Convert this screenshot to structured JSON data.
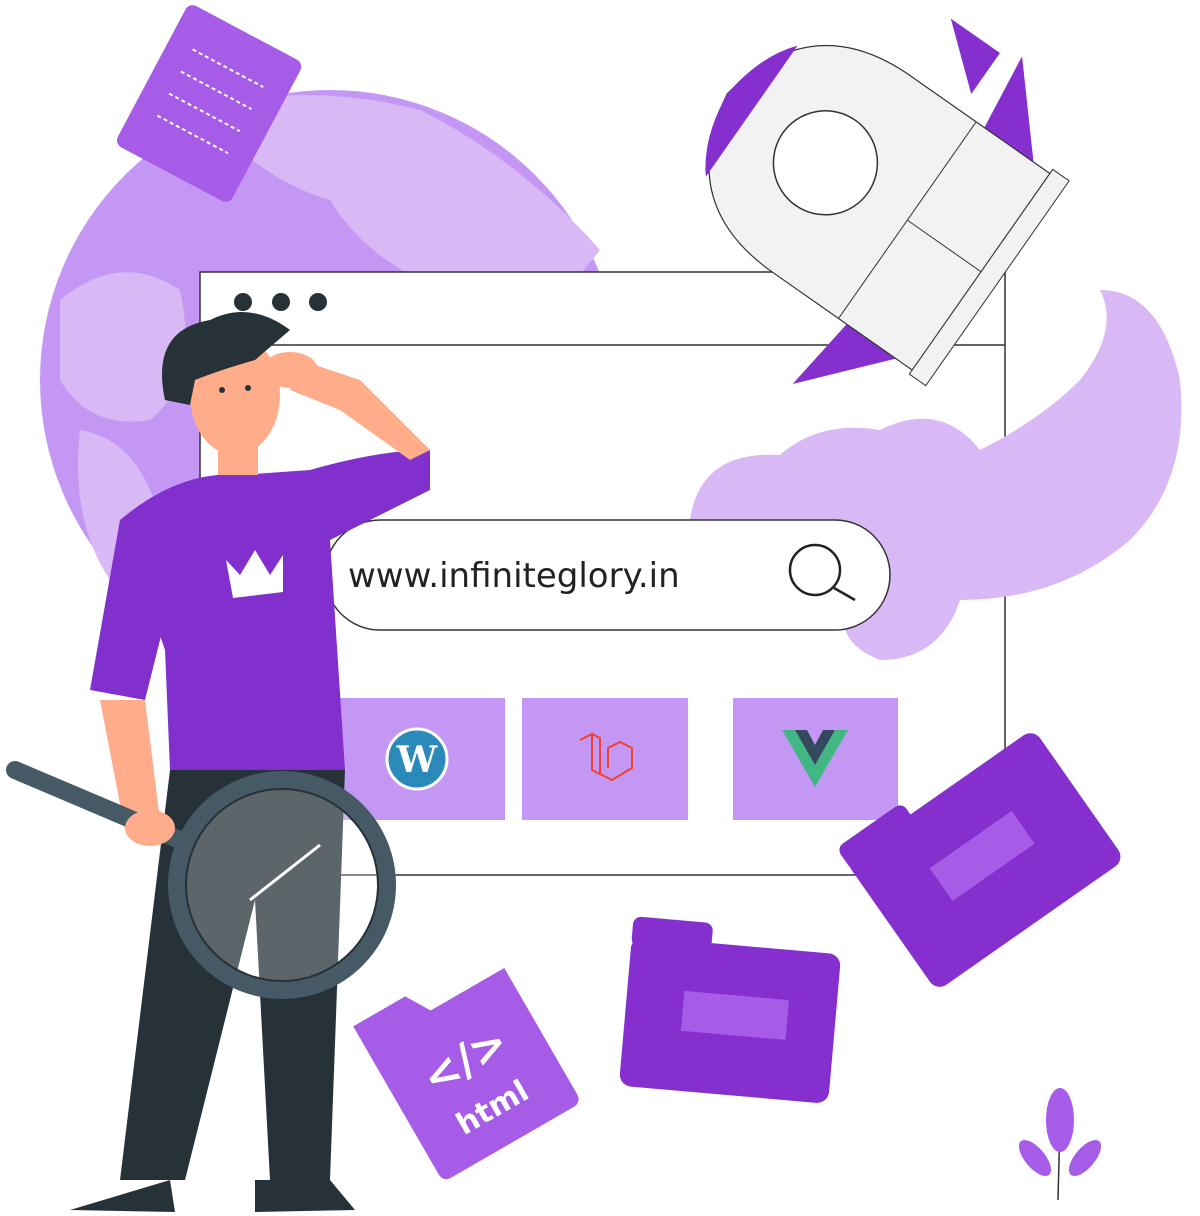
{
  "browser": {
    "search_url": "www.infiniteglory.in",
    "tiles": [
      {
        "name": "wordpress",
        "icon": "wordpress-logo-icon"
      },
      {
        "name": "laravel",
        "icon": "laravel-logo-icon"
      },
      {
        "name": "vue",
        "icon": "vue-logo-icon"
      }
    ]
  },
  "html_file": {
    "code_label": "</>",
    "file_label": "html"
  },
  "colors": {
    "purple_dark": "#842fce",
    "purple_mid": "#a75ce8",
    "purple_light": "#c597f5",
    "purple_pale": "#d9b8f6",
    "shirt": "#8230cd",
    "pants": "#263238",
    "skin": "#ffac8a"
  }
}
